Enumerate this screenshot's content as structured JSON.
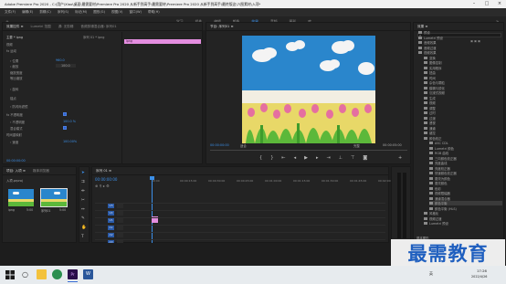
{
  "window": {
    "title": "Adobe Premiere Pro 2020 - C:\\用户\\Xiao\\桌面\\最需要材\\Premiere Pro 2020 从新手到高手\\最需要材\\Premiere Pro 2020 从新手到高手\\最终版这\\7\\图素材\\入项*"
  },
  "menu": [
    "文件(F)",
    "编辑(E)",
    "剪辑(C)",
    "序列(S)",
    "标记(M)",
    "图形(G)",
    "视图(V)",
    "窗口(W)",
    "帮助(H)"
  ],
  "workspaces": {
    "tabs": [
      "学习",
      "组件",
      "编辑",
      "颜色",
      "效果",
      "音频",
      "图形",
      "库"
    ],
    "active_index": 4
  },
  "effect_controls": {
    "tabs": [
      "效果控件 ≡",
      "Lumetri 范围",
      "源: 无剪辑",
      "音频剪辑混合器: 序列01"
    ],
    "header": "主要 * ipng",
    "clip_tag": "序列 01 * ipng",
    "timecode": "00:00:00:00",
    "rows": [
      {
        "label": "视频",
        "value": ""
      },
      {
        "label": "fx 运动",
        "value": ""
      },
      {
        "label": "› 位置",
        "value": "960.0"
      },
      {
        "label": "› 缩放",
        "value": "100.0"
      },
      {
        "label": "缩放宽度",
        "value": ""
      },
      {
        "label": "等比缩放",
        "value": ""
      },
      {
        "label": "› 旋转",
        "value": "0.0"
      },
      {
        "label": "锚点",
        "value": "960.0"
      },
      {
        "label": "› 防闪烁滤镜",
        "value": "0.00"
      },
      {
        "label": "fx 不透明度",
        "value": ""
      },
      {
        "label": "› 不透明度",
        "value": "100.0 %"
      },
      {
        "label": "混合模式",
        "value": "正常"
      },
      {
        "label": "时间重映射",
        "value": ""
      },
      {
        "label": "› 速度",
        "value": "100.00%"
      }
    ],
    "pink_bar": "ipng"
  },
  "program_monitor": {
    "tabs": [
      "节目: 序列01 ≡"
    ],
    "timecode_left": "00:00:00:00",
    "fit_label": "适合",
    "quality_label": "完整",
    "timecode_right": "00:00:05:00",
    "image_alt": "tulips under blue sky painting"
  },
  "project": {
    "tabs": [
      "项目: 入项 ≡",
      "媒体浏览器"
    ],
    "file_name": "入项.prproj",
    "items": [
      {
        "name": "ipng",
        "duration": "5:00"
      },
      {
        "name": "序列01",
        "duration": "5:00"
      }
    ]
  },
  "timeline": {
    "tab": "序列 01 ≡",
    "timecode": "00:00:00:00",
    "ruler": [
      "00:00",
      "00:00:15:00",
      "00:00:30:00",
      "00:00:45:00",
      "00:01:00:00",
      "00:01:15:00",
      "00:01:30:00",
      "00:01:45:00",
      "00:02:00:00"
    ],
    "tracks": [
      "V3",
      "V2",
      "V1",
      "A1",
      "A2",
      "A3"
    ],
    "master_label": "主声道",
    "master_value": "0.0"
  },
  "effects_panel": {
    "title": "效果 ≡",
    "folders": [
      "预设",
      "Lumetri 预设",
      "音频效果",
      "音频过渡",
      "视频效果",
      "变换",
      "图像控制",
      "实用程序",
      "扭曲",
      "时间",
      "杂色与颗粒",
      "模糊与锐化",
      "沉浸式视频",
      "生成",
      "视频",
      "调整",
      "过时",
      "过渡",
      "透视",
      "通道",
      "键控",
      "颜色校正"
    ],
    "subitems": [
      "ASC CDL",
      "Lumetri 颜色",
      "RGB 曲线",
      "三向颜色校正器",
      "亮度曲线",
      "亮度校正器",
      "快速颜色校正器",
      "更改为颜色",
      "更改颜色",
      "色彩",
      "视频限幅器",
      "通道混合器",
      "颜色平衡",
      "颜色平衡 (HLS)"
    ],
    "selected_subitem": "颜色平衡",
    "after_folders": [
      "风格化",
      "视频过渡",
      "Lumetri 预设"
    ],
    "bottom_labels": [
      "基本图形",
      "基本声音",
      "Lumetri 颜色",
      "库",
      "标记",
      "历史记录",
      "信息"
    ]
  },
  "watermark": "最需教育",
  "tray": {
    "time": "17:26",
    "date": "2022/4/26",
    "ime": "英"
  },
  "colors": {
    "accent_blue": "#3b8fe8",
    "clip_pink": "#e48ee0",
    "watermark_blue": "#1f5fbf"
  }
}
